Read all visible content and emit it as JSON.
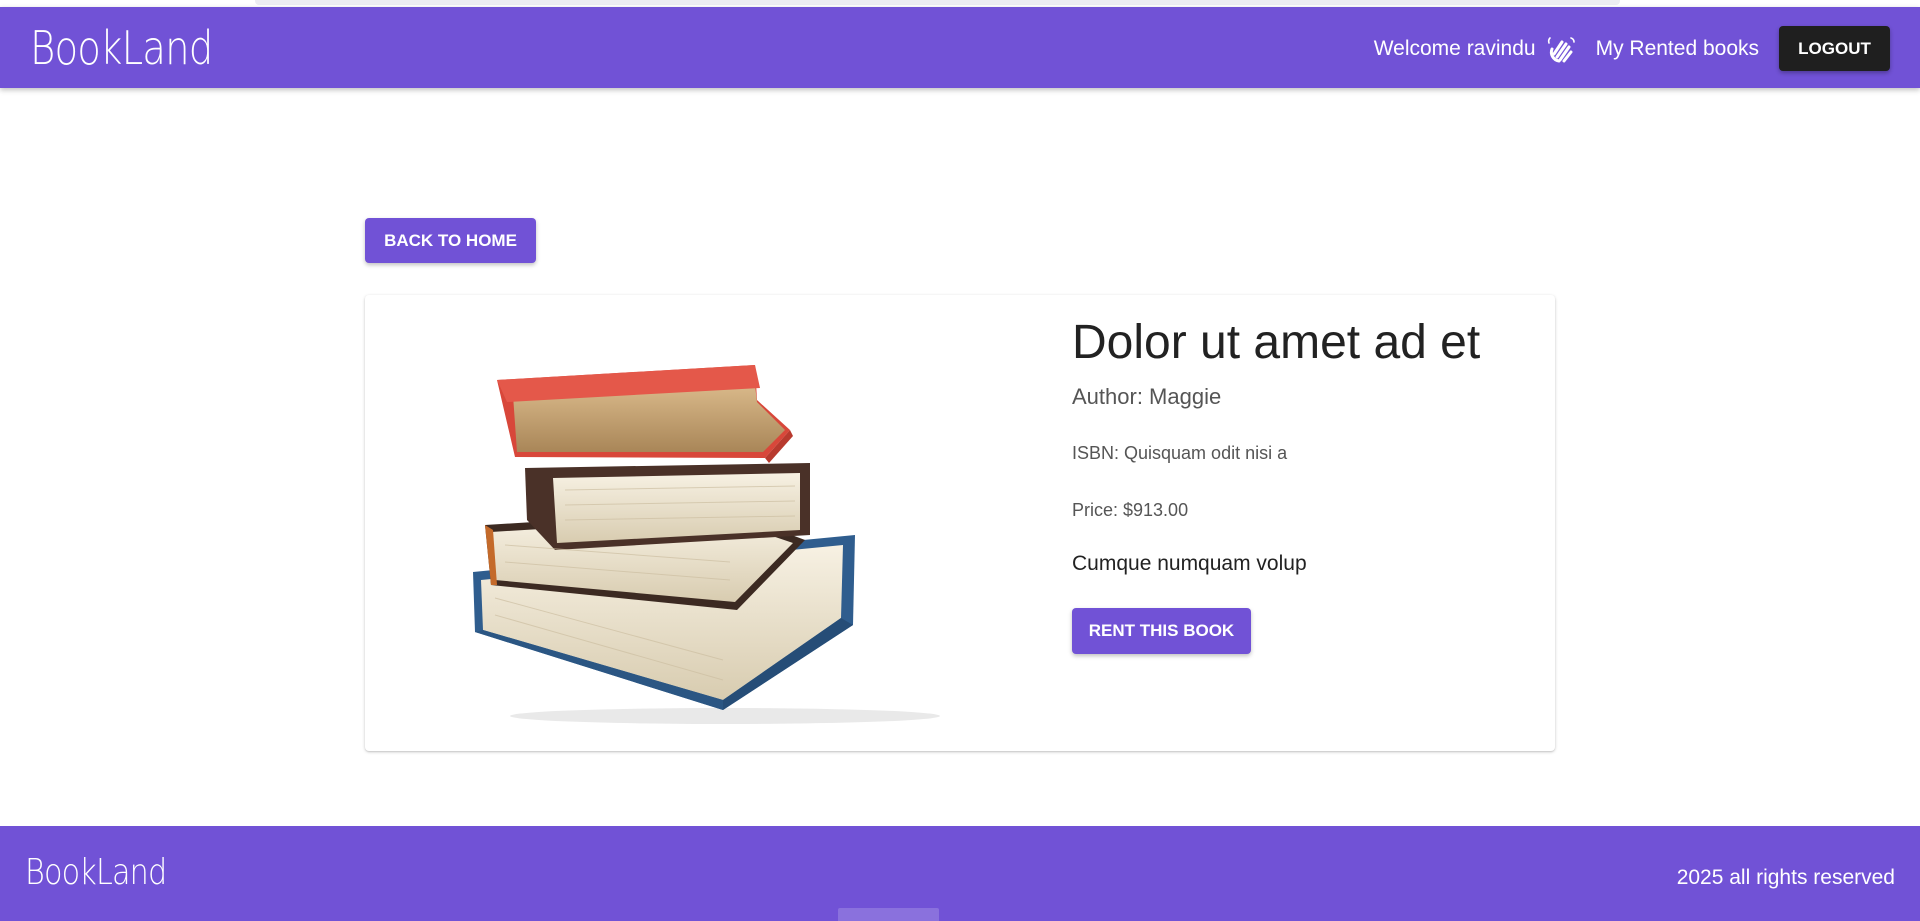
{
  "app": {
    "brand": "BookLand",
    "accent_color": "#7152d6",
    "dark_button_color": "#1f1f1f"
  },
  "navbar": {
    "welcome_text": "Welcome ravindu",
    "wave_icon": "waving-hand-icon",
    "rented_books_label": "My Rented books",
    "logout_label": "LOGOUT"
  },
  "page": {
    "back_label": "BACK TO HOME"
  },
  "book": {
    "image_icon": "stack-of-books-image",
    "title": "Dolor ut amet ad et",
    "author": "Author: Maggie",
    "isbn": "ISBN: Quisquam odit nisi a",
    "price": "Price: $913.00",
    "description": "Cumque numquam volup",
    "rent_label": "RENT THIS BOOK"
  },
  "footer": {
    "brand": "BookLand",
    "copyright": "2025 all rights reserved"
  }
}
